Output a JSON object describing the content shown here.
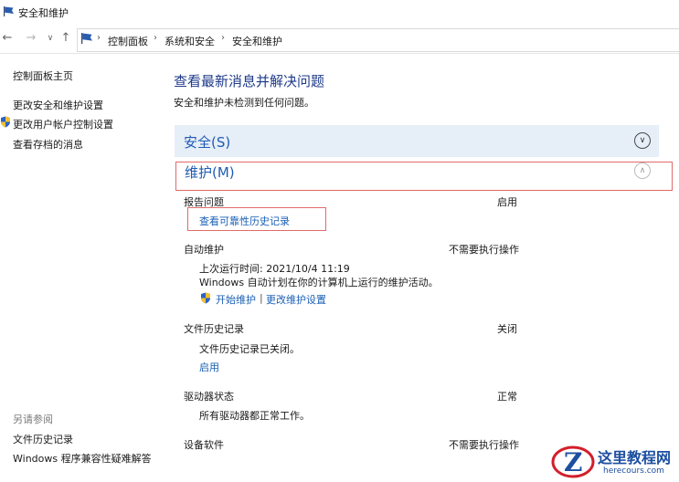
{
  "window": {
    "title": "安全和维护"
  },
  "breadcrumb": [
    "控制面板",
    "系统和安全",
    "安全和维护"
  ],
  "sidebar": {
    "items": [
      "控制面板主页",
      "更改安全和维护设置",
      "更改用户帐户控制设置",
      "查看存档的消息"
    ],
    "see_also_title": "另请参阅",
    "see_also": [
      "文件历史记录",
      "Windows 程序兼容性疑难解答"
    ]
  },
  "main": {
    "title": "查看最新消息并解决问题",
    "subtitle": "安全和维护未检测到任何问题。",
    "security_label": "安全(S)",
    "maintenance_label": "维护(M)",
    "report": {
      "label": "报告问题",
      "status": "启用",
      "link": "查看可靠性历史记录"
    },
    "auto": {
      "label": "自动维护",
      "status": "不需要执行操作",
      "last_run": "上次运行时间: 2021/10/4 11:19",
      "desc": "Windows 自动计划在你的计算机上运行的维护活动。",
      "start_link": "开始维护",
      "sep": "|",
      "settings_link": "更改维护设置"
    },
    "file_history": {
      "label": "文件历史记录",
      "status": "关闭",
      "desc": "文件历史记录已关闭。",
      "link": "启用"
    },
    "drive": {
      "label": "驱动器状态",
      "status": "正常",
      "desc": "所有驱动器都正常工作。"
    },
    "device_software": {
      "label": "设备软件",
      "status": "不需要执行操作"
    }
  },
  "watermark": {
    "name": "这里教程网",
    "url": "herecours.com",
    "logo_letter": "Z"
  },
  "colors": {
    "accent": "#1f5bb3",
    "header_bg": "#e6eef7",
    "highlight_box": "#e06a6a",
    "link": "#1a5fb4"
  }
}
